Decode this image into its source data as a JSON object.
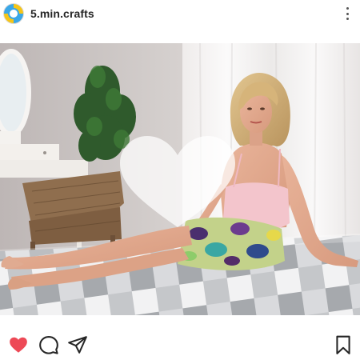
{
  "post": {
    "username": "5.min.crafts",
    "liked": true
  },
  "icons": {
    "avatar": "craft-logo-icon",
    "more": "more-vertical-icon",
    "like": "heart-filled-icon",
    "comment": "comment-icon",
    "share": "send-icon",
    "save": "bookmark-icon"
  },
  "colors": {
    "like": "#ed4956",
    "text": "#262626",
    "icon": "#262626"
  }
}
